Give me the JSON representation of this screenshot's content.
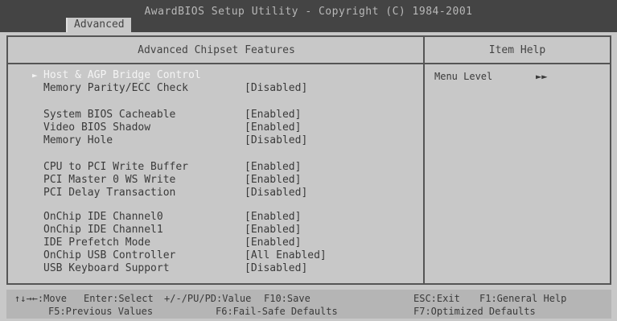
{
  "header": {
    "title": "AwardBIOS Setup Utility - Copyright (C) 1984-2001",
    "tab": "Advanced"
  },
  "panel": {
    "title": "Advanced Chipset Features",
    "help_title": "Item Help"
  },
  "settings": [
    {
      "label": "Host & AGP Bridge Control",
      "value": "",
      "selected": true
    },
    {
      "label": "Memory Parity/ECC Check",
      "value": "[Disabled]"
    },
    {
      "label": "System BIOS Cacheable",
      "value": "[Enabled]"
    },
    {
      "label": "Video BIOS Shadow",
      "value": "[Enabled]"
    },
    {
      "label": "Memory Hole",
      "value": "[Disabled]"
    },
    {
      "label": "CPU to PCI Write Buffer",
      "value": "[Enabled]"
    },
    {
      "label": "PCI Master 0 WS Write",
      "value": "[Enabled]"
    },
    {
      "label": "PCI Delay Transaction",
      "value": "[Disabled]"
    },
    {
      "label": "OnChip IDE Channel0",
      "value": "[Enabled]"
    },
    {
      "label": "OnChip IDE Channel1",
      "value": "[Enabled]"
    },
    {
      "label": "IDE Prefetch Mode",
      "value": "[Enabled]"
    },
    {
      "label": "OnChip USB Controller",
      "value": "[All Enabled]"
    },
    {
      "label": "USB Keyboard Support",
      "value": "[Disabled]"
    }
  ],
  "help": {
    "menu_level_label": "Menu Level",
    "menu_level_value": "►►"
  },
  "selected_marker": "►",
  "footer": {
    "row1": [
      "↑↓→←:Move",
      "Enter:Select",
      "+/-/PU/PD:Value",
      "F10:Save",
      "ESC:Exit",
      "F1:General Help"
    ],
    "row2": [
      "F5:Previous Values",
      "F6:Fail-Safe Defaults",
      "F7:Optimized Defaults"
    ]
  },
  "colors": {
    "background": "#c8c8c8",
    "title_bar": "#444444",
    "highlight_text": "#f4f4f4"
  }
}
